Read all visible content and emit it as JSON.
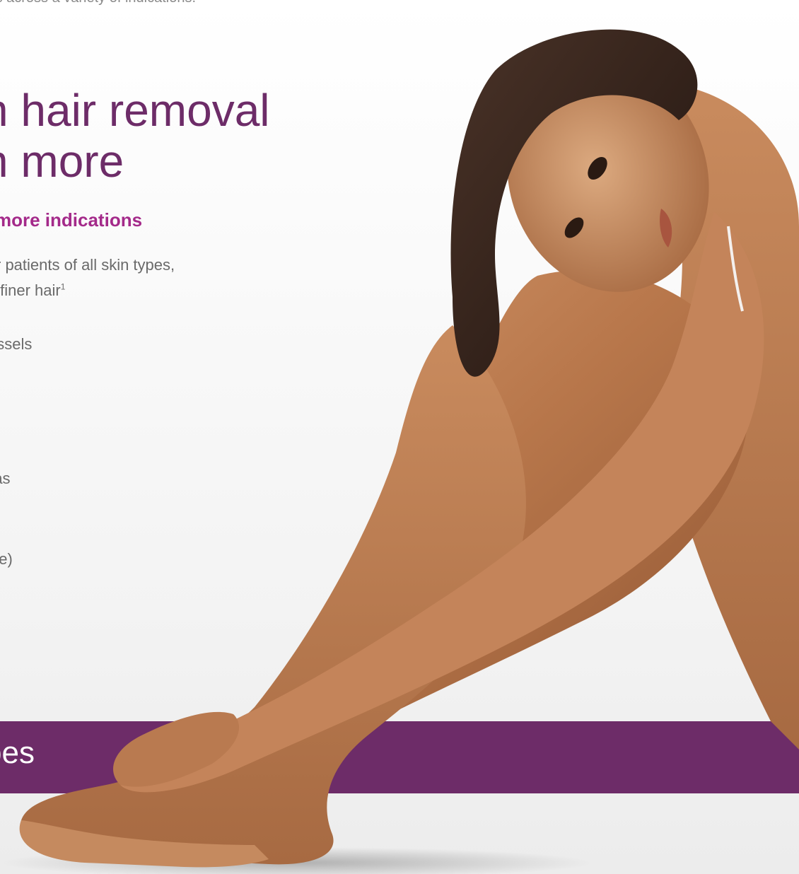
{
  "page": {
    "top_text": "ies across a variety of indications.",
    "headline_line1": "n hair removal",
    "headline_line2": "n more",
    "subheading": "more indications",
    "body_line1": "r patients of all skin types,",
    "body_line2": "/finer hair",
    "body_line2_sup": "1",
    "body_line3": "essels",
    "body_line4": "mas",
    "body_line5": "ae)",
    "band_text": "bes"
  },
  "colors": {
    "brand_purple": "#6d2c68",
    "accent_magenta": "#a42a8a",
    "body_gray": "#6a6a6a"
  },
  "image": {
    "subject": "woman-seated-hugging-knees-photo"
  }
}
